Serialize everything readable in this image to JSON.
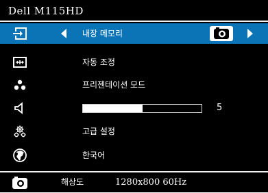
{
  "title": "Dell  M115HD",
  "menu": [
    {
      "icon": "input-source-icon",
      "label": "내장 메모리",
      "selected": true
    },
    {
      "icon": "auto-adjust-icon",
      "label": "자동 조정"
    },
    {
      "icon": "presentation-mode-icon",
      "label": "프리젠테이션 모드"
    },
    {
      "icon": "volume-icon",
      "label": "",
      "slider": {
        "value": 5,
        "max": 10
      }
    },
    {
      "icon": "advanced-settings-icon",
      "label": "고급 설정"
    },
    {
      "icon": "language-globe-icon",
      "label": "한국어"
    }
  ],
  "status": {
    "icon": "camera-icon",
    "label": "해상도",
    "value": "1280x800 60Hz"
  },
  "colors": {
    "background": "#000000",
    "highlight": "#0a74b6",
    "text": "#ffffff"
  }
}
